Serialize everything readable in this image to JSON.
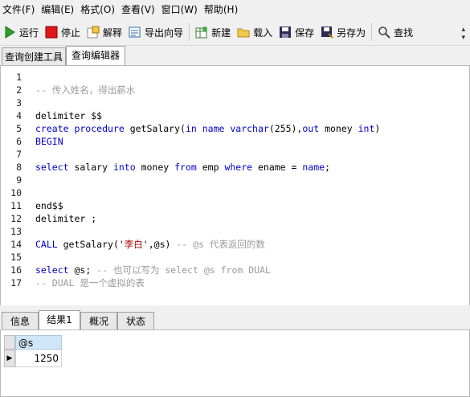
{
  "menubar": {
    "items": [
      "文件(F)",
      "编辑(E)",
      "格式(O)",
      "查看(V)",
      "窗口(W)",
      "帮助(H)"
    ]
  },
  "toolbar": {
    "run": "运行",
    "stop": "停止",
    "explain": "解释",
    "export_wizard": "导出向导",
    "new": "新建",
    "load": "载入",
    "save": "保存",
    "save_as": "另存为",
    "find": "查找"
  },
  "tabs_top": [
    "查询创建工具",
    "查询编辑器"
  ],
  "editor": {
    "line_numbers": [
      "1",
      "2",
      "3",
      "4",
      "5",
      "6",
      "7",
      "8",
      "9",
      "10",
      "11",
      "12",
      "13",
      "14",
      "15",
      "16",
      "17"
    ],
    "lines": {
      "l2_comment": "-- 传入姓名，得出薪水",
      "l4": "delimiter $$",
      "l5_kw1": "create procedure",
      "l5_mid": " getSalary(",
      "l5_kw2": "in name varchar",
      "l5_num": "(255),",
      "l5_kw3": "out",
      "l5_mid2": " money ",
      "l5_kw4": "int",
      "l5_end": ")",
      "l6": "BEGIN",
      "l8_kw1": "select",
      "l8_t1": " salary ",
      "l8_kw2": "into",
      "l8_t2": " money ",
      "l8_kw3": "from",
      "l8_t3": " emp ",
      "l8_kw4": "where",
      "l8_t4": " ename = ",
      "l8_kw5": "name",
      "l8_t5": ";",
      "l11": "end$$",
      "l12": "delimiter ;",
      "l14_kw": "CALL",
      "l14_t1": " getSalary('",
      "l14_str": "李白",
      "l14_t2": "',@s) ",
      "l14_comment": "-- @s 代表返回的数",
      "l16_kw": "select",
      "l16_t1": " @s; ",
      "l16_comment": "-- 也可以写为 select @s from DUAL",
      "l17_comment": "-- DUAL 是一个虚拟的表"
    }
  },
  "tabs_bottom": [
    "信息",
    "结果1",
    "概况",
    "状态"
  ],
  "result": {
    "column": "@s",
    "value": "1250"
  }
}
